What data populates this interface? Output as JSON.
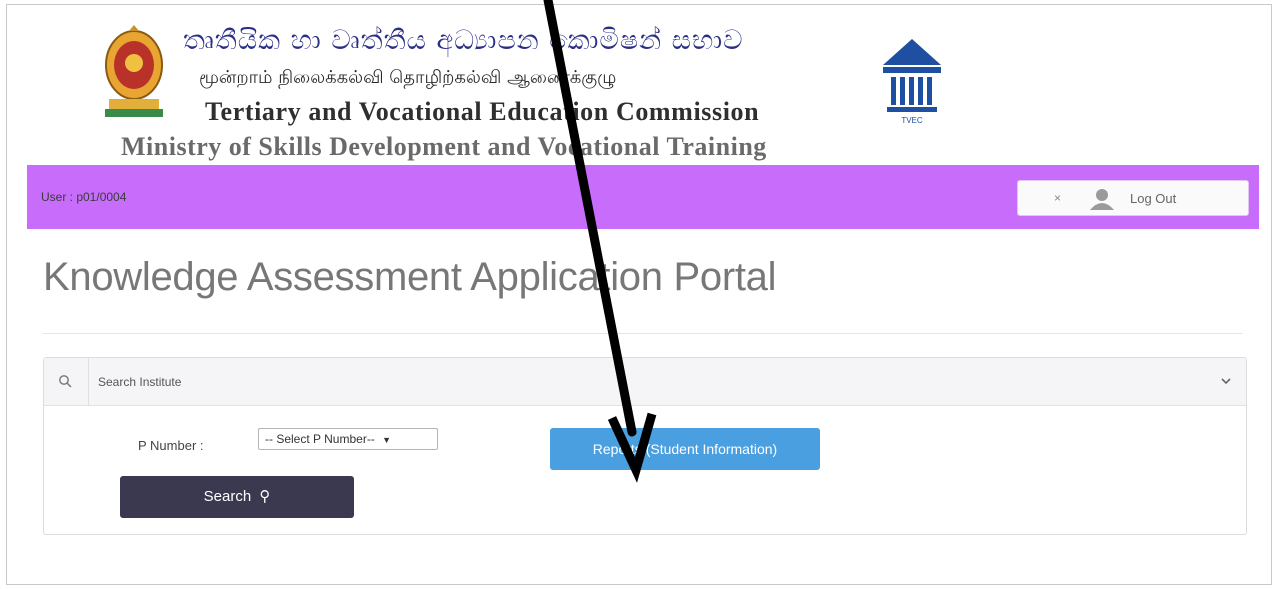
{
  "header": {
    "sinhala_title": "තෘතීයික හා වෘත්තීය අධ්‍යාපන කොමිෂන් සභාව",
    "tamil_title": "மூன்றாம் நிலைக்கல்வி தொழிற்கல்வி ஆணைக்குழு",
    "english_title": "Tertiary and Vocational Education Commission",
    "ministry": "Ministry of Skills Development and Vocational Training",
    "logo_text": "TVEC"
  },
  "topbar": {
    "user_label": "User : p01/0004",
    "logout_label": "Log Out",
    "bar_color": "#c86dfb"
  },
  "page": {
    "title": "Knowledge Assessment Application Portal"
  },
  "search_panel": {
    "header_label": "Search Institute",
    "p_number_label": "P Number",
    "p_number_select_value": "-- Select P Number--",
    "reports_button": "Reports (Student Information)",
    "search_button": "Search"
  },
  "colors": {
    "reports_button": "#4a9fe0",
    "search_button": "#3a3950"
  }
}
